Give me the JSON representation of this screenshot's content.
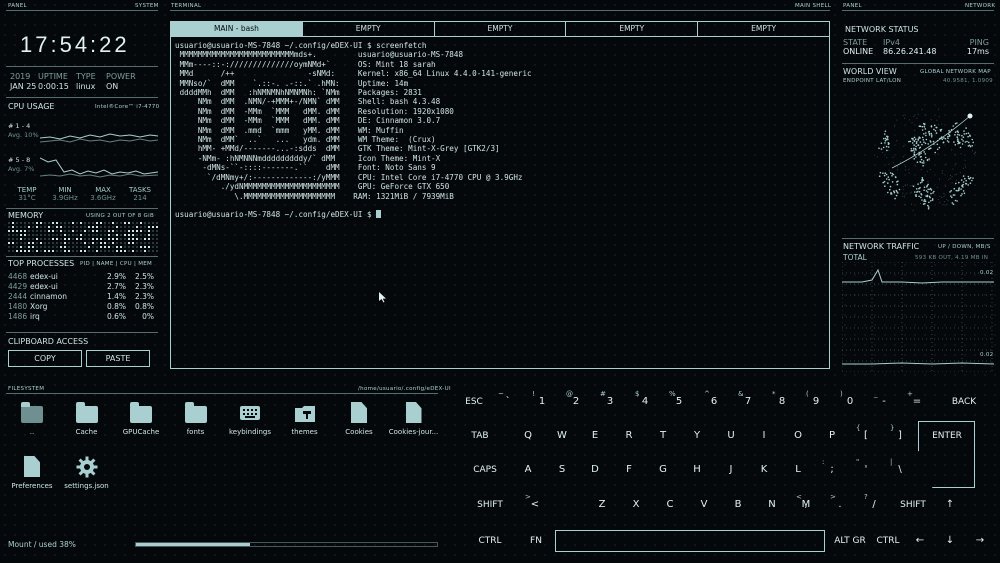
{
  "panels": {
    "left_top": "PANEL",
    "left_top_right": "SYSTEM",
    "center_top": "TERMINAL",
    "center_top_right": "MAIN SHELL",
    "right_top": "PANEL",
    "right_top_right": "NETWORK",
    "filesystem": "FILESYSTEM",
    "filesystem_path": "/home/usuario/.config/eDEX-UI"
  },
  "clock": "17:54:22",
  "system": {
    "year": "2019",
    "date": "JAN 25",
    "uptime_label": "UPTIME",
    "uptime": "0:00:15",
    "type_label": "TYPE",
    "type": "linux",
    "power_label": "POWER",
    "power": "ON"
  },
  "cpu": {
    "title": "CPU USAGE",
    "model": "Intel®Core™ i7-4770",
    "core1_label": "# 1 - 4",
    "core1_avg": "Avg. 10%",
    "core2_label": "# 5 - 8",
    "core2_avg": "Avg. 7%",
    "temp_label": "TEMP",
    "temp": "31°C",
    "min_label": "MIN",
    "min": "3.9GHz",
    "max_label": "MAX",
    "max": "3.6GHz",
    "tasks_label": "TASKS",
    "tasks": "214"
  },
  "memory": {
    "title": "MEMORY",
    "usage": "USING 2 OUT OF 8 GiB"
  },
  "processes": {
    "title": "TOP PROCESSES",
    "header": "PID | NAME | CPU | MEM",
    "rows": [
      {
        "pid": "4468",
        "name": "edex-ui",
        "cpu": "2.9%",
        "mem": "2.5%"
      },
      {
        "pid": "4429",
        "name": "edex-ui",
        "cpu": "2.7%",
        "mem": "2.3%"
      },
      {
        "pid": "2444",
        "name": "cinnamon",
        "cpu": "1.4%",
        "mem": "2.3%"
      },
      {
        "pid": "1480",
        "name": "Xorg",
        "cpu": "0.8%",
        "mem": "0.8%"
      },
      {
        "pid": "1486",
        "name": "irq",
        "cpu": "0.6%",
        "mem": "0%"
      }
    ]
  },
  "clipboard": {
    "title": "CLIPBOARD ACCESS",
    "copy": "COPY",
    "paste": "PASTE"
  },
  "terminal": {
    "tabs": [
      "MAIN - bash",
      "EMPTY",
      "EMPTY",
      "EMPTY",
      "EMPTY"
    ],
    "prompt1": "usuario@usuario-MS-7848 ~/.config/eDEX-UI $ screenfetch",
    "lines": [
      " MMMMMMMMMMMMMMMMMMMMMMMMMmds+.         usuario@usuario-MS-7848",
      " MMm----::-://////////////oymNMd+`      OS: Mint 18 sarah",
      " MMd      /++                -sNMd:     Kernel: x86_64 Linux 4.4.0-141-generic",
      " MMNso/`  dMM    `.::-. .-::.` .hMN:    Uptime: 14m",
      " ddddMMh  dMM   :hNMNMNhNMNMNh: `NMm    Packages: 2831",
      "     NMm  dMM  .NMN/-+MMM+-/NMN` dMM    Shell: bash 4.3.48",
      "     NMm  dMM  -MMm  `MMM   dMM. dMM    Resolution: 1920x1080",
      "     NMm  dMM  -MMm  `MMM   dMM. dMM    DE: Cinnamon 3.0.7",
      "     NMm  dMM  .mmd  `mmm   yMM. dMM    WM: Muffin",
      "     NMm  dMM`  ..`   ...   ydm. dMM    WM Theme:  (Crux)",
      "     hMM- +MMd/-------...-:sdds  dMM    GTK Theme: Mint-X-Grey [GTK2/3]",
      "     -NMm- :hNMNNNmdddddddddy/` dMM     Icon Theme: Mint-X",
      "      -dMNs-``-::::-------.``    dMM    Font: Noto Sans 9",
      "       `/dMNmy+/:-------------:/yMMM    CPU: Intel Core i7-4770 CPU @ 3.9GHz",
      "          ./ydNMMMMMMMMMMMMMMMMMMMMM    GPU: GeForce GTX 650",
      "             \\.MMMMMMMMMMMMMMMMMMMM    RAM: 1321MiB / 7939MiB"
    ],
    "prompt2": "usuario@usuario-MS-7848 ~/.config/eDEX-UI $ "
  },
  "network": {
    "title": "NETWORK STATUS",
    "state_label": "STATE",
    "state": "ONLINE",
    "ipv4_label": "IPv4",
    "ipv4": "86.26.241.48",
    "ping_label": "PING",
    "ping": "17ms",
    "world_title": "WORLD VIEW",
    "world_sub": "GLOBAL NETWORK MAP",
    "endpoint_label": "ENDPOINT LAT/LON",
    "endpoint": "40.9581, 1.0909",
    "traffic_title": "NETWORK TRAFFIC",
    "traffic_sub": "UP / DOWN, MB/S",
    "total_label": "TOTAL",
    "total": "593 KB OUT, 4.19 MB IN",
    "up_scale": "0.02",
    "down_scale": "0.02"
  },
  "filesystem": {
    "items": [
      {
        "name": "..",
        "icon": "folder-up-icon"
      },
      {
        "name": "Cache",
        "icon": "folder-icon"
      },
      {
        "name": "GPUCache",
        "icon": "folder-icon"
      },
      {
        "name": "fonts",
        "icon": "folder-icon"
      },
      {
        "name": "keybindings",
        "icon": "keyboard-icon"
      },
      {
        "name": "themes",
        "icon": "theme-icon"
      },
      {
        "name": "Cookies",
        "icon": "file-icon"
      },
      {
        "name": "Cookies-jour...",
        "icon": "file-icon"
      },
      {
        "name": "Preferences",
        "icon": "file-icon"
      },
      {
        "name": "settings.json",
        "icon": "gear-icon"
      }
    ],
    "mount_label": "Mount / used",
    "mount_used": "38%",
    "mount_used_fraction": 0.38
  },
  "keyboard": {
    "row1": [
      {
        "k": "ESC",
        "s": ""
      },
      {
        "k": "`",
        "s": "~"
      },
      {
        "k": "1",
        "s": "!"
      },
      {
        "k": "2",
        "s": "@"
      },
      {
        "k": "3",
        "s": "#"
      },
      {
        "k": "4",
        "s": "$"
      },
      {
        "k": "5",
        "s": "%"
      },
      {
        "k": "6",
        "s": "^"
      },
      {
        "k": "7",
        "s": "&"
      },
      {
        "k": "8",
        "s": "*"
      },
      {
        "k": "9",
        "s": "("
      },
      {
        "k": "0",
        "s": ")"
      },
      {
        "k": "-",
        "s": "_"
      },
      {
        "k": "=",
        "s": "+"
      },
      {
        "k": "BACK",
        "s": ""
      }
    ],
    "row2": [
      "TAB",
      "Q",
      "W",
      "E",
      "R",
      "T",
      "Y",
      "U",
      "I",
      "O",
      "P",
      "[",
      "]",
      "ENTER"
    ],
    "row2_sup": {
      "[": "{",
      "]": "}"
    },
    "row3": [
      "CAPS",
      "A",
      "S",
      "D",
      "F",
      "G",
      "H",
      "J",
      "K",
      "L",
      ";",
      "'",
      "\\"
    ],
    "row3_sup": {
      ";": ":",
      "'": "\"",
      "\\": "|"
    },
    "row4": [
      "SHIFT",
      "<",
      "Z",
      "X",
      "C",
      "V",
      "B",
      "N",
      "M",
      ",",
      ".",
      "/",
      "SHIFT",
      "↑"
    ],
    "row4_sup": {
      "<": ">",
      ",": "<",
      ".": ">",
      "/": "?"
    },
    "row5": [
      "CTRL",
      "FN",
      "ALT GR",
      "CTRL",
      "←",
      "↓",
      "→"
    ]
  },
  "colors": {
    "accent": "#aacfd1",
    "background": "#05080a"
  }
}
